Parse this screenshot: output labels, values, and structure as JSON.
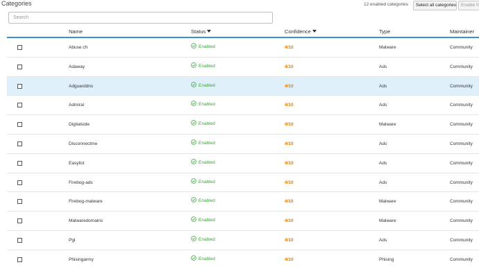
{
  "header": {
    "title": "Categories",
    "enabled_count": "12 enabled categories",
    "select_all_label": "Select all categories",
    "enable_label": "Enable 0 c"
  },
  "search": {
    "placeholder": "Search",
    "value": ""
  },
  "columns": {
    "name": "Name",
    "status": "Status",
    "confidence": "Confidence",
    "type": "Type",
    "maintainer": "Maintainer"
  },
  "icons": {
    "status_enabled": "check-circle-icon",
    "sort": "sort-down-arrow-icon"
  },
  "colors": {
    "enabled": "#3aa33a",
    "confidence": "#e07b00",
    "accent": "#3a8ed4",
    "row_highlight": "#dff0fb"
  },
  "rows": [
    {
      "name": "Abuse ch",
      "status": "Enabled",
      "confidence": "4/10",
      "type": "Malware",
      "maintainer": "Community",
      "checked": false,
      "highlighted": false
    },
    {
      "name": "Adaway",
      "status": "Enabled",
      "confidence": "4/10",
      "type": "Ads",
      "maintainer": "Community",
      "checked": false,
      "highlighted": false
    },
    {
      "name": "Adguarddns",
      "status": "Enabled",
      "confidence": "4/10",
      "type": "Ads",
      "maintainer": "Community",
      "checked": false,
      "highlighted": true
    },
    {
      "name": "Admiral",
      "status": "Enabled",
      "confidence": "4/10",
      "type": "Ads",
      "maintainer": "Community",
      "checked": false,
      "highlighted": false
    },
    {
      "name": "Digitalside",
      "status": "Enabled",
      "confidence": "4/10",
      "type": "Malware",
      "maintainer": "Community",
      "checked": false,
      "highlighted": false
    },
    {
      "name": "Disconnectme",
      "status": "Enabled",
      "confidence": "4/10",
      "type": "Ads",
      "maintainer": "Community",
      "checked": false,
      "highlighted": false
    },
    {
      "name": "Easylist",
      "status": "Enabled",
      "confidence": "4/10",
      "type": "Ads",
      "maintainer": "Community",
      "checked": false,
      "highlighted": false
    },
    {
      "name": "Firebog-ads",
      "status": "Enabled",
      "confidence": "4/10",
      "type": "Ads",
      "maintainer": "Community",
      "checked": false,
      "highlighted": false
    },
    {
      "name": "Firebog-malware",
      "status": "Enabled",
      "confidence": "4/10",
      "type": "Malware",
      "maintainer": "Community",
      "checked": false,
      "highlighted": false
    },
    {
      "name": "Malwaredomains",
      "status": "Enabled",
      "confidence": "4/10",
      "type": "Malware",
      "maintainer": "Community",
      "checked": false,
      "highlighted": false
    },
    {
      "name": "Pgl",
      "status": "Enabled",
      "confidence": "4/10",
      "type": "Ads",
      "maintainer": "Community",
      "checked": false,
      "highlighted": false
    },
    {
      "name": "Phisingarmy",
      "status": "Enabled",
      "confidence": "4/10",
      "type": "Phising",
      "maintainer": "Community",
      "checked": false,
      "highlighted": false
    }
  ]
}
